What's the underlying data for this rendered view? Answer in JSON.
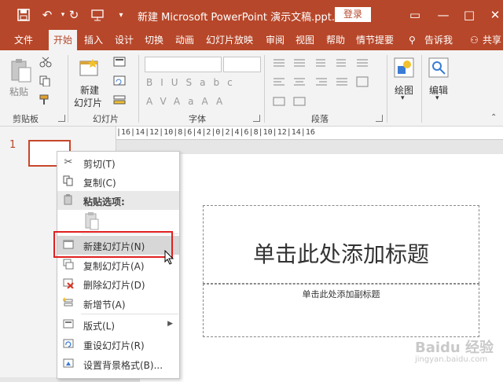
{
  "window": {
    "title": "新建 Microsoft PowerPoint 演示文稿.ppt...",
    "login": "登录",
    "qat": [
      "save-icon",
      "undo-icon",
      "redo-icon",
      "presenter-icon",
      "customize-icon"
    ],
    "controls": {
      "restore": "▭",
      "minimize": "—",
      "maximize": "□",
      "close": "✕"
    }
  },
  "tabs": [
    "文件",
    "开始",
    "插入",
    "设计",
    "切换",
    "动画",
    "幻灯片放映",
    "审阅",
    "视图",
    "帮助",
    "情节提要",
    "告诉我",
    "共享"
  ],
  "ribbon": {
    "clipboard": {
      "paste": "粘贴",
      "label": "剪贴板"
    },
    "slides": {
      "new_slide": "新建\n幻灯片",
      "new_slide_l1": "新建",
      "new_slide_l2": "幻灯片",
      "label": "幻灯片"
    },
    "font": {
      "label": "字体",
      "buttons": [
        "B",
        "I",
        "U",
        "S",
        "abc",
        "AV",
        "Aa",
        "A",
        "A"
      ]
    },
    "paragraph": {
      "label": "段落"
    },
    "drawing": {
      "label": "绘图"
    },
    "editing": {
      "label": "编辑"
    }
  },
  "ruler": "|16|14|12|10|8|6|4|2|0|2|4|6|8|10|12|14|16",
  "thumbnails": {
    "slide_number": "1"
  },
  "slide": {
    "title_placeholder": "单击此处添加标题",
    "subtitle_placeholder": "单击此处添加副标题"
  },
  "context_menu": {
    "items": [
      {
        "label": "剪切(T)",
        "icon": "scissors-icon"
      },
      {
        "label": "复制(C)",
        "icon": "copy-icon"
      },
      {
        "label": "粘贴选项:",
        "icon": "paste-icon",
        "header": true
      },
      {
        "label": "",
        "icon": "paste-keep-icon"
      },
      {
        "label": "新建幻灯片(N)",
        "icon": "new-slide-icon"
      },
      {
        "label": "复制幻灯片(A)",
        "icon": "duplicate-slide-icon"
      },
      {
        "label": "删除幻灯片(D)",
        "icon": "delete-slide-icon"
      },
      {
        "label": "新增节(A)",
        "icon": "add-section-icon"
      },
      {
        "label": "版式(L)",
        "icon": "layout-icon"
      },
      {
        "label": "重设幻灯片(R)",
        "icon": "reset-slide-icon"
      },
      {
        "label": "设置背景格式(B)...",
        "icon": "format-background-icon"
      }
    ]
  },
  "watermark": {
    "brand": "Baidu 经验",
    "url": "jingyan.baidu.com"
  },
  "colors": {
    "accent": "#b7472a",
    "highlight": "#e02020"
  }
}
